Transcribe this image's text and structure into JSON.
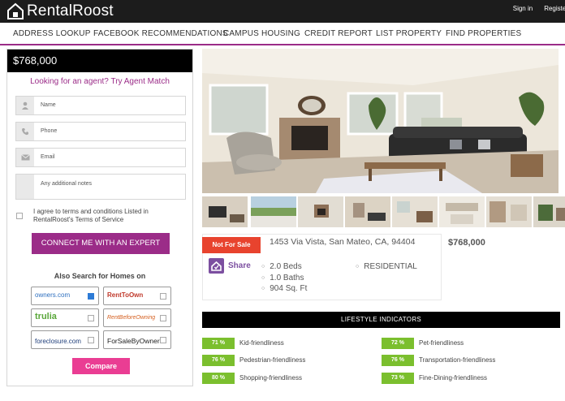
{
  "header": {
    "logo_text": "RentalRoost",
    "sign_in": "Sign in",
    "register": "Register"
  },
  "nav": {
    "items": [
      "ADDRESS LOOKUP",
      "FACEBOOK RECOMMENDATIONS",
      "CAMPUS HOUSING",
      "CREDIT REPORT",
      "LIST PROPERTY",
      "FIND PROPERTIES"
    ]
  },
  "form": {
    "price": "$768,000",
    "title": "Looking for an agent? Try Agent Match",
    "name_placeholder": "Name",
    "phone_placeholder": "Phone",
    "email_placeholder": "Email",
    "notes_placeholder": "Any additional notes",
    "terms_text": "I agree to terms and conditions Listed in RentalRoost's Terms of Service",
    "connect_label": "CONNECT ME WITH AN EXPERT",
    "also_search": "Also Search for Homes on",
    "partners": [
      {
        "label": "owners.com",
        "checked": true
      },
      {
        "label": "RentToOwn",
        "checked": false
      },
      {
        "label": "trulia",
        "checked": false
      },
      {
        "label": "RentBeforeOwning",
        "checked": false
      },
      {
        "label": "foreclosure.com",
        "checked": false
      },
      {
        "label": "ForSaleByOwner",
        "checked": false
      }
    ],
    "compare_label": "Compare"
  },
  "listing": {
    "status": "Not For Sale",
    "address": "1453 Via Vista, San Mateo, CA, 94404",
    "price": "$768,000",
    "share_label": "Share",
    "beds": "2.0 Beds",
    "baths": "1.0 Baths",
    "sqft": "904 Sq. Ft",
    "type": "RESIDENTIAL"
  },
  "lifestyle": {
    "title": "LIFESTYLE INDICATORS",
    "items": [
      {
        "pct": "71 %",
        "label": "Kid-friendliness"
      },
      {
        "pct": "72 %",
        "label": "Pet-friendliness"
      },
      {
        "pct": "76 %",
        "label": "Pedestrian-friendliness"
      },
      {
        "pct": "76 %",
        "label": "Transportation-friendliness"
      },
      {
        "pct": "80 %",
        "label": "Shopping-friendliness"
      },
      {
        "pct": "73 %",
        "label": "Fine-Dining-friendliness"
      }
    ]
  },
  "colors": {
    "brand_purple": "#9b2c88",
    "compare_pink": "#ea3d93",
    "status_red": "#e8432e",
    "lifestyle_green": "#7bbf2e"
  }
}
